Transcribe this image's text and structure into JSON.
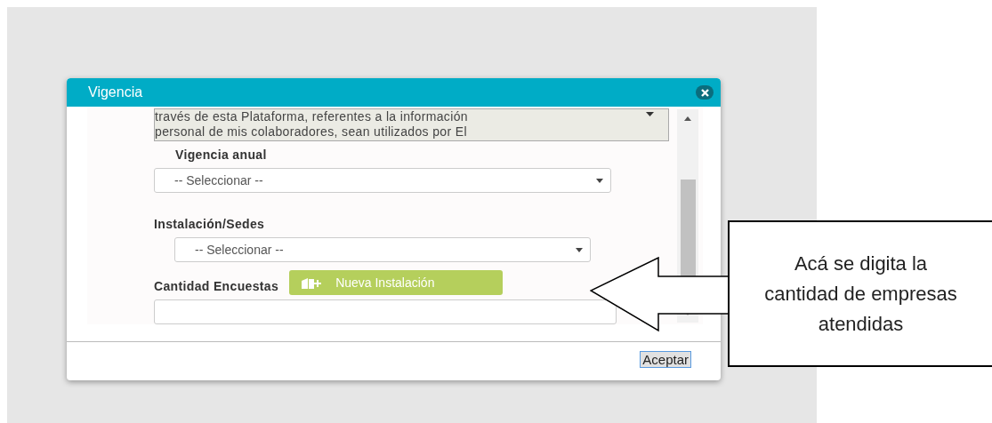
{
  "dialog": {
    "title": "Vigencia",
    "terms_text": [
      "través de esta Plataforma, referentes a la información",
      "personal de mis colaboradores, sean utilizados por El"
    ],
    "fields": [
      {
        "kind": "select",
        "label": "Vigencia anual",
        "placeholder": "-- Seleccionar --"
      },
      {
        "kind": "select",
        "label": "Instalación/Sedes",
        "placeholder": "-- Seleccionar --"
      },
      {
        "kind": "input",
        "label": "Cantidad Encuestas",
        "button": "Nueva Instalación"
      }
    ],
    "footer_button": "Aceptar"
  },
  "callout": {
    "text": "Acá se digita la cantidad de empresas atendidas"
  }
}
